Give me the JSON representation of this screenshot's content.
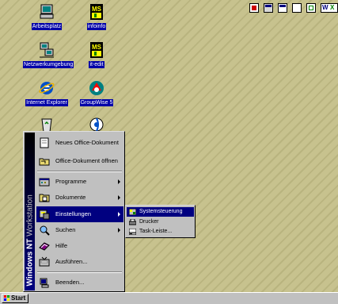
{
  "desktop": {
    "icons": [
      {
        "label": "Arbeitsplatz",
        "icon": "my-computer-icon"
      },
      {
        "label": "infoinfo",
        "icon": "ms-application-icon"
      },
      {
        "label": "Netzwerkumgebung",
        "icon": "network-neighborhood-icon"
      },
      {
        "label": "it-edit",
        "icon": "ms-application-icon"
      },
      {
        "label": "Internet Explorer",
        "icon": "internet-explorer-icon"
      },
      {
        "label": "GroupWise 5",
        "icon": "groupwise-icon"
      }
    ]
  },
  "start_menu": {
    "banner_bold": "Windows NT",
    "banner_light": " Workstation",
    "items": [
      {
        "label": "Neues Office-Dokument",
        "icon": "new-office-document-icon"
      },
      {
        "label": "Office-Dokument öffnen",
        "icon": "open-office-document-icon"
      },
      {
        "label": "Programme",
        "icon": "programs-icon"
      },
      {
        "label": "Dokumente",
        "icon": "documents-icon"
      },
      {
        "label": "Einstellungen",
        "icon": "settings-icon"
      },
      {
        "label": "Suchen",
        "icon": "search-icon"
      },
      {
        "label": "Hilfe",
        "icon": "help-icon"
      },
      {
        "label": "Ausführen...",
        "icon": "run-icon"
      },
      {
        "label": "Beenden...",
        "icon": "shutdown-icon"
      }
    ]
  },
  "settings_submenu": {
    "items": [
      {
        "label": "Systemsteuerung",
        "icon": "control-panel-icon"
      },
      {
        "label": "Drucker",
        "icon": "printers-icon"
      },
      {
        "label": "Task-Leiste...",
        "icon": "taskbar-icon"
      }
    ]
  },
  "taskbar": {
    "start_label": "Start"
  },
  "colors": {
    "desktop": "#c7c28e",
    "highlight": "#000080",
    "menu_face": "#c0c0c0"
  }
}
